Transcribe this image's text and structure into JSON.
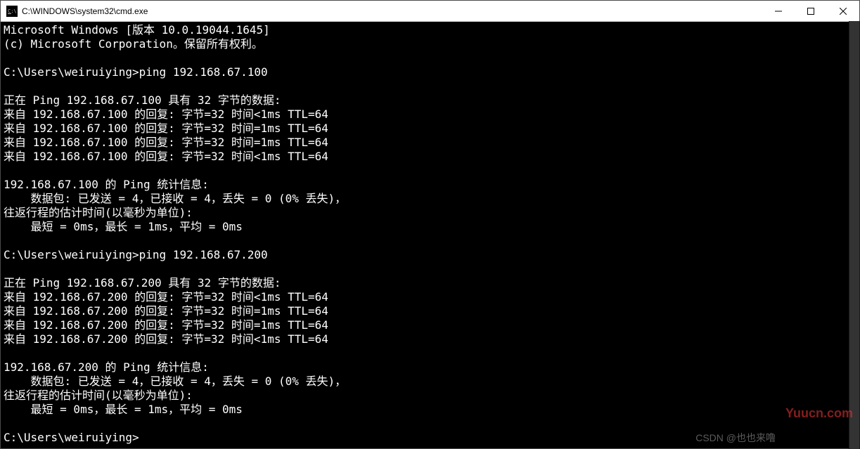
{
  "titlebar": {
    "title": "C:\\WINDOWS\\system32\\cmd.exe"
  },
  "terminal": {
    "lines": [
      "Microsoft Windows [版本 10.0.19044.1645]",
      "(c) Microsoft Corporation。保留所有权利。",
      "",
      "C:\\Users\\weiruiying>ping 192.168.67.100",
      "",
      "正在 Ping 192.168.67.100 具有 32 字节的数据:",
      "来自 192.168.67.100 的回复: 字节=32 时间<1ms TTL=64",
      "来自 192.168.67.100 的回复: 字节=32 时间=1ms TTL=64",
      "来自 192.168.67.100 的回复: 字节=32 时间=1ms TTL=64",
      "来自 192.168.67.100 的回复: 字节=32 时间<1ms TTL=64",
      "",
      "192.168.67.100 的 Ping 统计信息:",
      "    数据包: 已发送 = 4，已接收 = 4，丢失 = 0 (0% 丢失)，",
      "往返行程的估计时间(以毫秒为单位):",
      "    最短 = 0ms，最长 = 1ms，平均 = 0ms",
      "",
      "C:\\Users\\weiruiying>ping 192.168.67.200",
      "",
      "正在 Ping 192.168.67.200 具有 32 字节的数据:",
      "来自 192.168.67.200 的回复: 字节=32 时间<1ms TTL=64",
      "来自 192.168.67.200 的回复: 字节=32 时间=1ms TTL=64",
      "来自 192.168.67.200 的回复: 字节=32 时间=1ms TTL=64",
      "来自 192.168.67.200 的回复: 字节=32 时间<1ms TTL=64",
      "",
      "192.168.67.200 的 Ping 统计信息:",
      "    数据包: 已发送 = 4，已接收 = 4，丢失 = 0 (0% 丢失)，",
      "往返行程的估计时间(以毫秒为单位):",
      "    最短 = 0ms，最长 = 1ms，平均 = 0ms",
      "",
      "C:\\Users\\weiruiying>"
    ]
  },
  "watermarks": {
    "csdn": "CSDN @也也来噜",
    "yuucn": "Yuucn.com"
  }
}
